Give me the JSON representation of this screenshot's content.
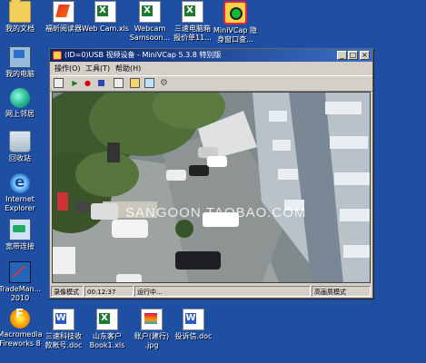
{
  "desktop_icons": [
    {
      "name": "desktop-icon-my-documents",
      "label": "我的文档",
      "glyph": "g-folder"
    },
    {
      "name": "desktop-icon-reader",
      "label": "福昕阅读器",
      "glyph": "g-reader"
    },
    {
      "name": "desktop-icon-webcam-xls",
      "label": "Web Cam.xls",
      "glyph": "g-doc xls"
    },
    {
      "name": "desktop-icon-webcam-samsoon",
      "label": "Webcam\nSamsoon...",
      "glyph": "g-doc xls"
    },
    {
      "name": "desktop-icon-report",
      "label": "三速电脑箱\n报价单11...",
      "glyph": "g-doc xls"
    },
    {
      "name": "desktop-icon-minivcap",
      "label": "MiniVCap 隐\n身窗口查...",
      "glyph": "g-cam"
    },
    {
      "name": "desktop-icon-my-computer",
      "label": "我的电脑",
      "glyph": "g-pc"
    },
    {
      "name": "desktop-icon-network",
      "label": "网上邻居",
      "glyph": "g-net"
    },
    {
      "name": "desktop-icon-recycle-bin",
      "label": "回收站",
      "glyph": "g-bin"
    },
    {
      "name": "desktop-icon-ie",
      "label": "Internet\nExplorer",
      "glyph": "g-ie"
    },
    {
      "name": "desktop-icon-broadband",
      "label": "宽带连接",
      "glyph": "g-bb"
    },
    {
      "name": "desktop-icon-trademanager",
      "label": "TradeMan...\n2010",
      "glyph": "g-chart"
    },
    {
      "name": "desktop-icon-fireworks",
      "label": "Macromedia\nFireworks 8",
      "glyph": "g-fw"
    },
    {
      "name": "desktop-icon-tech-doc",
      "label": "三速科技收\n款帐号.doc",
      "glyph": "g-doc word"
    },
    {
      "name": "desktop-icon-customer-xls",
      "label": "山东客户\nBook1.xls",
      "glyph": "g-doc xls"
    },
    {
      "name": "desktop-icon-account-jpg",
      "label": "账户(建行)\n.jpg",
      "glyph": "g-doc jpg"
    },
    {
      "name": "desktop-icon-complaint-doc",
      "label": "投诉信.doc",
      "glyph": "g-doc word"
    }
  ],
  "window": {
    "title": "(ID=0)USB 视频设备 - MiniVCap 5.3.8 特别版",
    "menu": [
      "操作(O)",
      "工具(T)",
      "帮助(H)"
    ],
    "toolbar_icons": [
      "window-icon",
      "play-icon",
      "record-icon",
      "stop-icon",
      "preview-icon",
      "folder-snapshot-icon",
      "schedule-icon",
      "settings-icon"
    ],
    "watermark": "SANGOON.TAOBAO.COM",
    "status": {
      "mode": "录像模式",
      "time": "00:12:37",
      "state": "运行中...",
      "quality": "高画质模式"
    }
  },
  "colors": {
    "desktop": "#1f4fa3",
    "titlebar": "#0a246a",
    "chrome": "#d4d0c8"
  }
}
